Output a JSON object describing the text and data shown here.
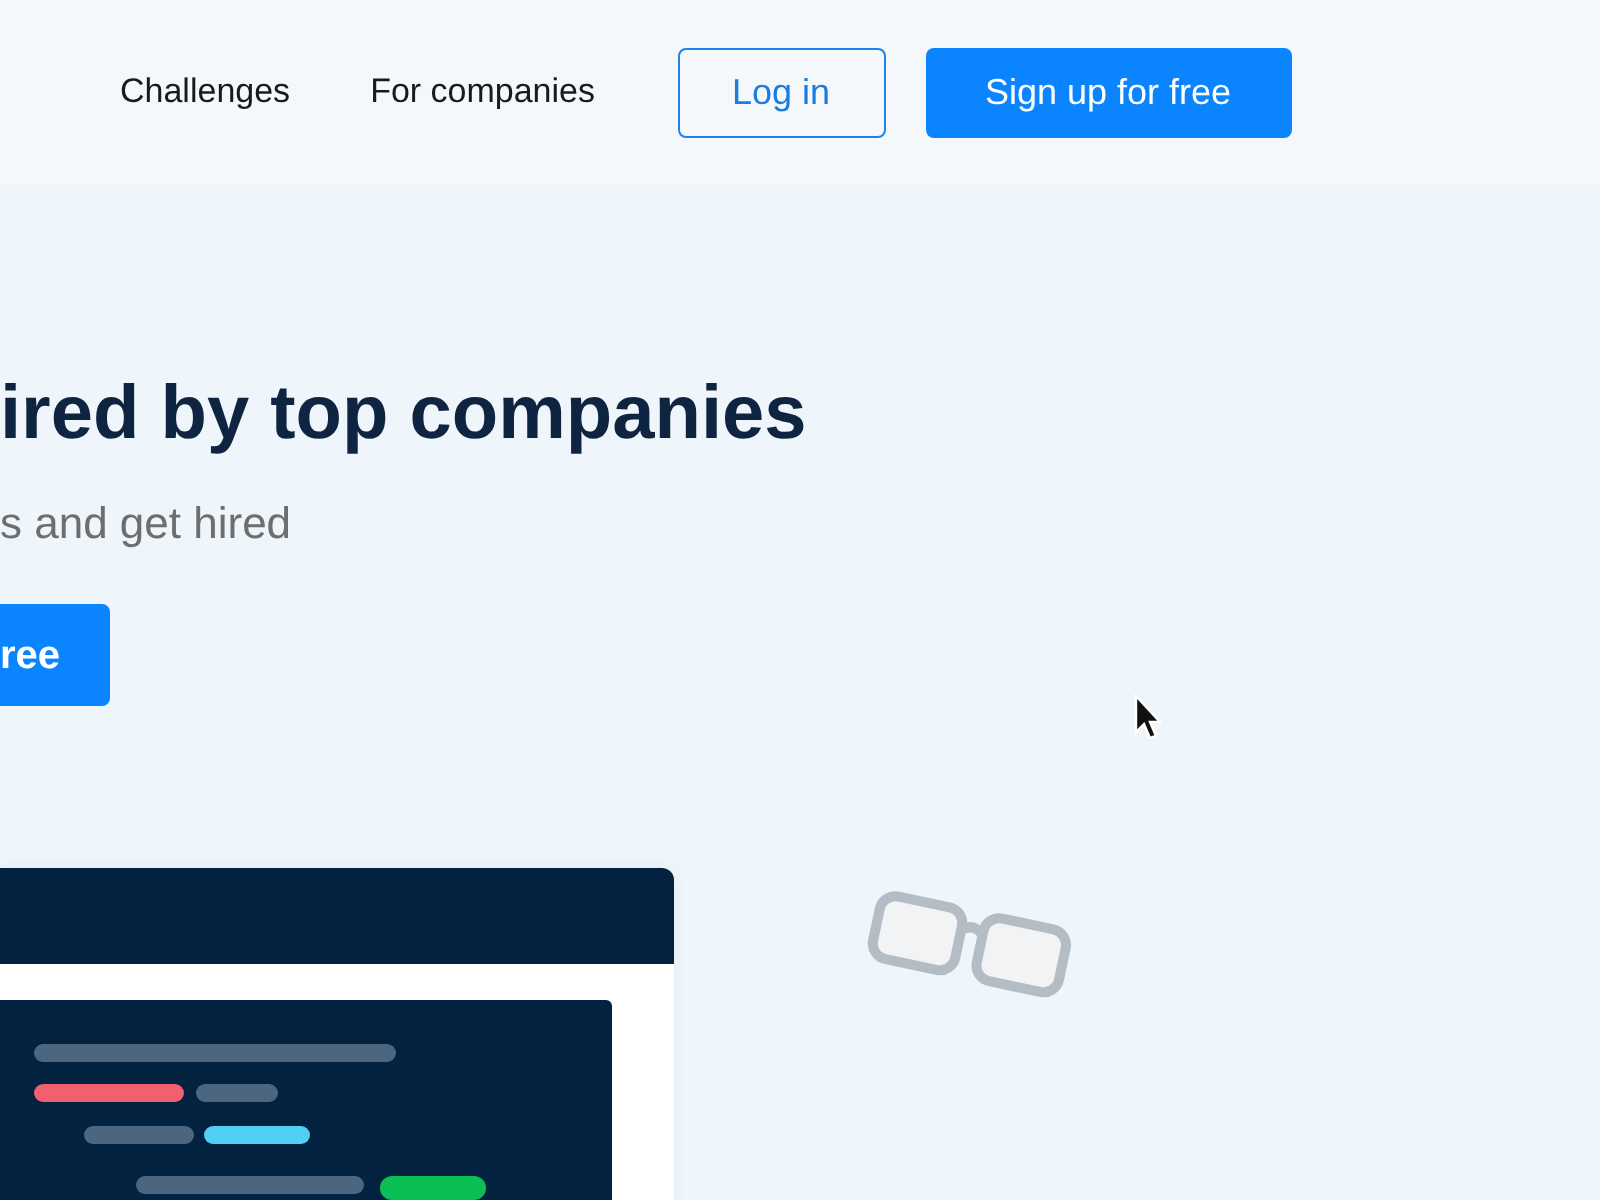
{
  "nav": {
    "links": [
      "Challenges",
      "For companies"
    ],
    "login": "Log in",
    "signup": "Sign up for free"
  },
  "hero": {
    "heading": "ired by top companies",
    "subheading": "s and get hired",
    "cta": "ree"
  }
}
